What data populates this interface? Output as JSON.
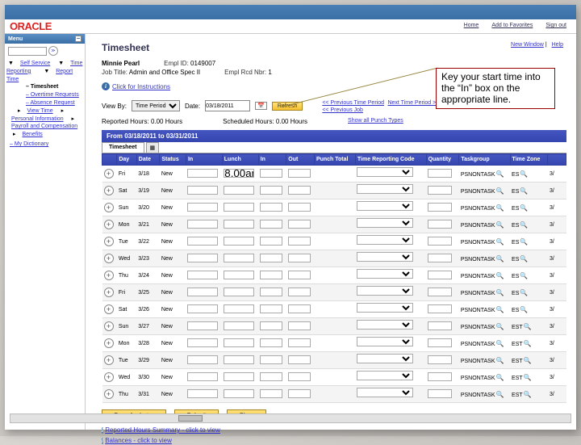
{
  "logo": "ORACLE",
  "topnav": {
    "home": "Home",
    "addfav": "Add to Favorites",
    "signout": "Sign out"
  },
  "sublinks": {
    "newwin": "New Window",
    "help": "Help"
  },
  "sidebar": {
    "menu_label": "Menu",
    "search_placeholder": "",
    "items": [
      "Self Service",
      "Time Reporting",
      "Report Time"
    ],
    "selected": "Timesheet",
    "subs": [
      "Overtime Requests",
      "Absence Request"
    ],
    "cats": [
      "View Time",
      "Personal Information",
      "Payroll and Compensation",
      "Benefits"
    ],
    "dict": "My Dictionary"
  },
  "page": {
    "title": "Timesheet",
    "emp_name": "Minnie Pearl",
    "job_title_lbl": "Job Title:",
    "job_title_val": "Admin and Office Spec II",
    "emplid_lbl": "Empl ID:",
    "emplid_val": "0149007",
    "emplrcd_lbl": "Empl Rcd Nbr:",
    "emplrcd_val": "1",
    "instructions": "Click for Instructions",
    "viewby_lbl": "View By:",
    "viewby_val": "Time Period",
    "date_lbl": "Date:",
    "date_val": "03/18/2011",
    "refresh": "Refresh",
    "prev_period": "<< Previous Time Period",
    "next_period": "Next Time Period >>",
    "prev_job": "<< Previous Job",
    "reported_lbl": "Reported Hours:",
    "reported_val": "0.00 Hours",
    "sched_lbl": "Scheduled Hours:",
    "sched_val": "0.00 Hours",
    "show_all": "Show all Punch Types",
    "period_bar": "From 03/18/2011 to 03/31/2011",
    "tabs": {
      "t1": "Timesheet"
    }
  },
  "headers": [
    "",
    "Day",
    "Date",
    "Status",
    "In",
    "Lunch",
    "In",
    "Out",
    "Punch Total",
    "Time Reporting Code",
    "Quantity",
    "Taskgroup",
    "Time Zone",
    ""
  ],
  "rows": [
    {
      "day": "Fri",
      "date": "3/18",
      "status": "New",
      "in": "",
      "lunch": "8.00am",
      "task": "PSNONTASK",
      "tz": "ES"
    },
    {
      "day": "Sat",
      "date": "3/19",
      "status": "New",
      "in": "",
      "lunch": "",
      "task": "PSNONTASK",
      "tz": "ES"
    },
    {
      "day": "Sun",
      "date": "3/20",
      "status": "New",
      "in": "",
      "lunch": "",
      "task": "PSNONTASK",
      "tz": "ES"
    },
    {
      "day": "Mon",
      "date": "3/21",
      "status": "New",
      "in": "",
      "lunch": "",
      "task": "PSNONTASK",
      "tz": "ES"
    },
    {
      "day": "Tue",
      "date": "3/22",
      "status": "New",
      "in": "",
      "lunch": "",
      "task": "PSNONTASK",
      "tz": "ES"
    },
    {
      "day": "Wed",
      "date": "3/23",
      "status": "New",
      "in": "",
      "lunch": "",
      "task": "PSNONTASK",
      "tz": "ES"
    },
    {
      "day": "Thu",
      "date": "3/24",
      "status": "New",
      "in": "",
      "lunch": "",
      "task": "PSNONTASK",
      "tz": "ES"
    },
    {
      "day": "Fri",
      "date": "3/25",
      "status": "New",
      "in": "",
      "lunch": "",
      "task": "PSNONTASK",
      "tz": "ES"
    },
    {
      "day": "Sat",
      "date": "3/26",
      "status": "New",
      "in": "",
      "lunch": "",
      "task": "PSNONTASK",
      "tz": "ES"
    },
    {
      "day": "Sun",
      "date": "3/27",
      "status": "New",
      "in": "",
      "lunch": "",
      "task": "PSNONTASK",
      "tz": "EST"
    },
    {
      "day": "Mon",
      "date": "3/28",
      "status": "New",
      "in": "",
      "lunch": "",
      "task": "PSNONTASK",
      "tz": "EST"
    },
    {
      "day": "Tue",
      "date": "3/29",
      "status": "New",
      "in": "",
      "lunch": "",
      "task": "PSNONTASK",
      "tz": "EST"
    },
    {
      "day": "Wed",
      "date": "3/30",
      "status": "New",
      "in": "",
      "lunch": "",
      "task": "PSNONTASK",
      "tz": "EST"
    },
    {
      "day": "Thu",
      "date": "3/31",
      "status": "New",
      "in": "",
      "lunch": "",
      "task": "PSNONTASK",
      "tz": "EST"
    }
  ],
  "buttons": {
    "save": "Save for Later",
    "submit": "Submit",
    "clear": "Clear"
  },
  "summary": {
    "line1": "Reported Hours Summary - click to view",
    "line2": "Balances - click to view"
  },
  "callout": "Key your start time into the “In” box on the appropriate line."
}
